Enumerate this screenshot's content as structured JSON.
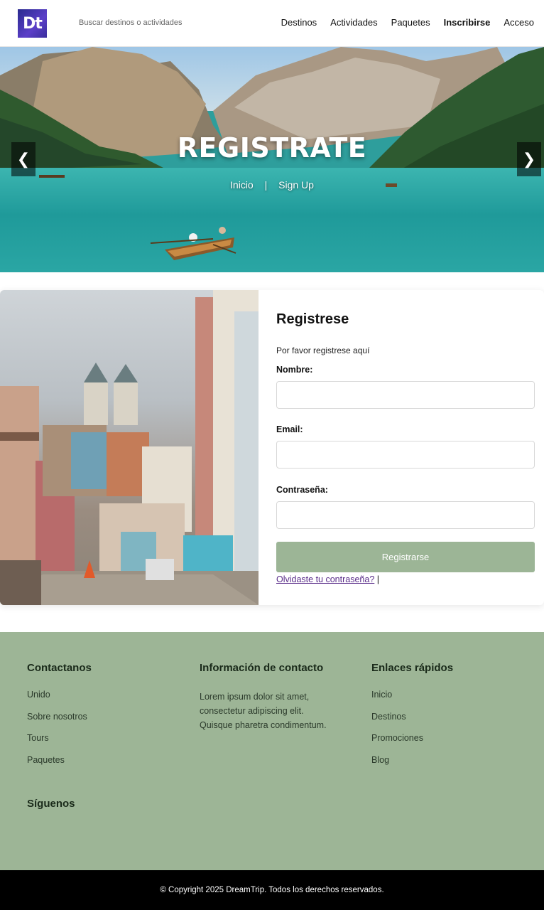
{
  "header": {
    "logo_text": "Dt",
    "search_placeholder": "Buscar destinos o actividades",
    "nav": [
      "Destinos",
      "Actividades",
      "Paquetes",
      "Inscribirse",
      "Acceso"
    ]
  },
  "hero": {
    "title": "REGISTRATE",
    "crumb_home": "Inicio",
    "crumb_separator": "|",
    "crumb_current": "Sign Up",
    "prev_arrow": "❮",
    "next_arrow": "❯"
  },
  "form": {
    "title": "Registrese",
    "subtitle": "Por favor registrese aquí",
    "name_label": "Nombre:",
    "email_label": "Email:",
    "password_label": "Contraseña:",
    "submit_label": "Registrarse",
    "forgot_link": "Olvidaste tu contraseña?",
    "forgot_suffix": "|"
  },
  "footer": {
    "col1_title": "Contactanos",
    "col1_items": [
      "Unido",
      "Sobre nosotros",
      "Tours",
      "Paquetes"
    ],
    "col2_title": "Información de contacto",
    "col2_text": "Lorem ipsum dolor sit amet, consectetur adipiscing elit. Quisque pharetra condimentum.",
    "col3_title": "Enlaces rápidos",
    "col3_items": [
      "Inicio",
      "Destinos",
      "Promociones",
      "Blog"
    ],
    "follow_title": "Síguenos",
    "copyright": "© Copyright 2025 DreamTrip. Todos los derechos reservados."
  },
  "colors": {
    "accent": "#9cb596",
    "footer_bg": "#9db596",
    "bottom_bar": "#000000",
    "link": "#5a2d8a"
  }
}
